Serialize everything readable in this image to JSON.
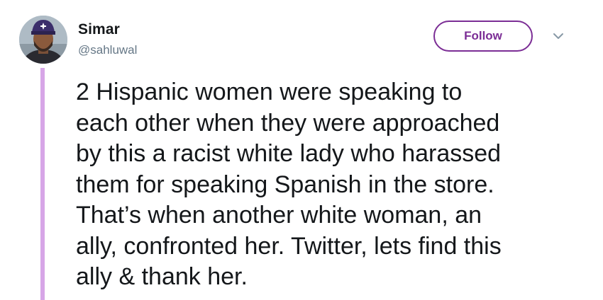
{
  "author": {
    "display_name": "Simar",
    "handle": "@sahluwal"
  },
  "follow_label": "Follow",
  "tweet_lines": [
    "2 Hispanic women were speaking to",
    "each other when they were approached",
    "by this a racist white lady who harassed",
    "them for speaking Spanish in the store.",
    "That’s when another white woman, an",
    "ally, confronted her. Twitter, lets find this",
    "ally & thank her."
  ],
  "icons": {
    "avatar": "profile-photo",
    "menu": "chevron-down-icon"
  },
  "colors": {
    "accent": "#7b2d95",
    "thread_line": "#d7a6e7",
    "handle": "#657786",
    "text": "#14171a"
  }
}
